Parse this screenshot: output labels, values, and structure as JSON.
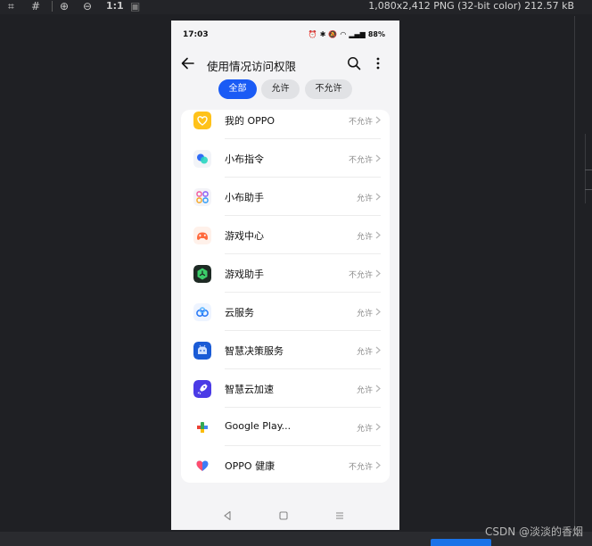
{
  "viewer": {
    "zoom_label": "1:1",
    "image_info": "1,080x2,412 PNG (32-bit color) 212.57 kB",
    "watermark": "CSDN @淡淡的香烟"
  },
  "status_bar": {
    "time": "17:03",
    "battery": "88%"
  },
  "header": {
    "title": "使用情况访问权限"
  },
  "filters": {
    "all": "全部",
    "allowed": "允许",
    "not_allowed": "不允许",
    "selected": "全部"
  },
  "apps": [
    {
      "name": "我的 OPPO",
      "status": "不允许",
      "icon": "my-oppo-icon"
    },
    {
      "name": "小布指令",
      "status": "不允许",
      "icon": "breeno-command-icon"
    },
    {
      "name": "小布助手",
      "status": "允许",
      "icon": "breeno-assistant-icon"
    },
    {
      "name": "游戏中心",
      "status": "允许",
      "icon": "game-center-icon"
    },
    {
      "name": "游戏助手",
      "status": "不允许",
      "icon": "game-assistant-icon"
    },
    {
      "name": "云服务",
      "status": "允许",
      "icon": "cloud-service-icon"
    },
    {
      "name": "智慧决策服务",
      "status": "允许",
      "icon": "smart-decision-icon"
    },
    {
      "name": "智慧云加速",
      "status": "允许",
      "icon": "smart-cloud-accelerate-icon"
    },
    {
      "name": "Google Play...",
      "status": "允许",
      "icon": "google-play-icon"
    },
    {
      "name": "OPPO 健康",
      "status": "不允许",
      "icon": "oppo-health-icon"
    }
  ],
  "colors": {
    "accent": "#1a5bf5",
    "chip_inactive": "#e1e2e5",
    "page_bg": "#f4f4f6"
  }
}
